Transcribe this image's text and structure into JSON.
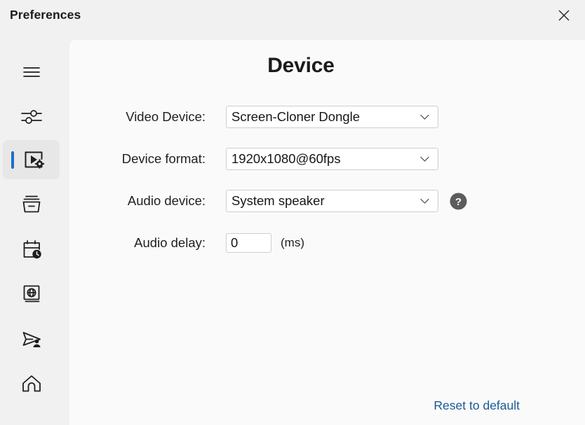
{
  "window": {
    "title": "Preferences",
    "close_icon": "close-icon"
  },
  "sidebar": {
    "items": [
      {
        "name": "menu",
        "icon": "hamburger-menu-icon",
        "label": "Menu",
        "selected": false
      },
      {
        "name": "general",
        "icon": "sliders-icon",
        "label": "General",
        "selected": false
      },
      {
        "name": "device",
        "icon": "video-settings-icon",
        "label": "Device",
        "selected": true
      },
      {
        "name": "capture",
        "icon": "archive-box-icon",
        "label": "Capture",
        "selected": false
      },
      {
        "name": "schedule",
        "icon": "calendar-clock-icon",
        "label": "Schedule",
        "selected": false
      },
      {
        "name": "network",
        "icon": "globe-book-icon",
        "label": "Network",
        "selected": false
      },
      {
        "name": "stream",
        "icon": "paper-plane-user-icon",
        "label": "Stream",
        "selected": false
      },
      {
        "name": "home",
        "icon": "home-icon",
        "label": "Home",
        "selected": false
      }
    ]
  },
  "main": {
    "title": "Device",
    "fields": {
      "video_device": {
        "label": "Video Device:",
        "value": "Screen-Cloner Dongle"
      },
      "device_format": {
        "label": "Device format:",
        "value": "1920x1080@60fps"
      },
      "audio_device": {
        "label": "Audio device:",
        "value": "System speaker",
        "help_icon": "help-circle-icon"
      },
      "audio_delay": {
        "label": "Audio delay:",
        "value": "0",
        "placeholder": "0",
        "unit": "(ms)"
      }
    },
    "reset_link": "Reset to default"
  },
  "colors": {
    "accent": "#1e6fc4",
    "link": "#1a5a94",
    "sidebar_bg": "#f1f1f1",
    "content_bg": "#fafafa",
    "selected_bg": "#e7e7e7",
    "icon": "#1f1f1f",
    "help_icon_bg": "#5c5c5c"
  }
}
